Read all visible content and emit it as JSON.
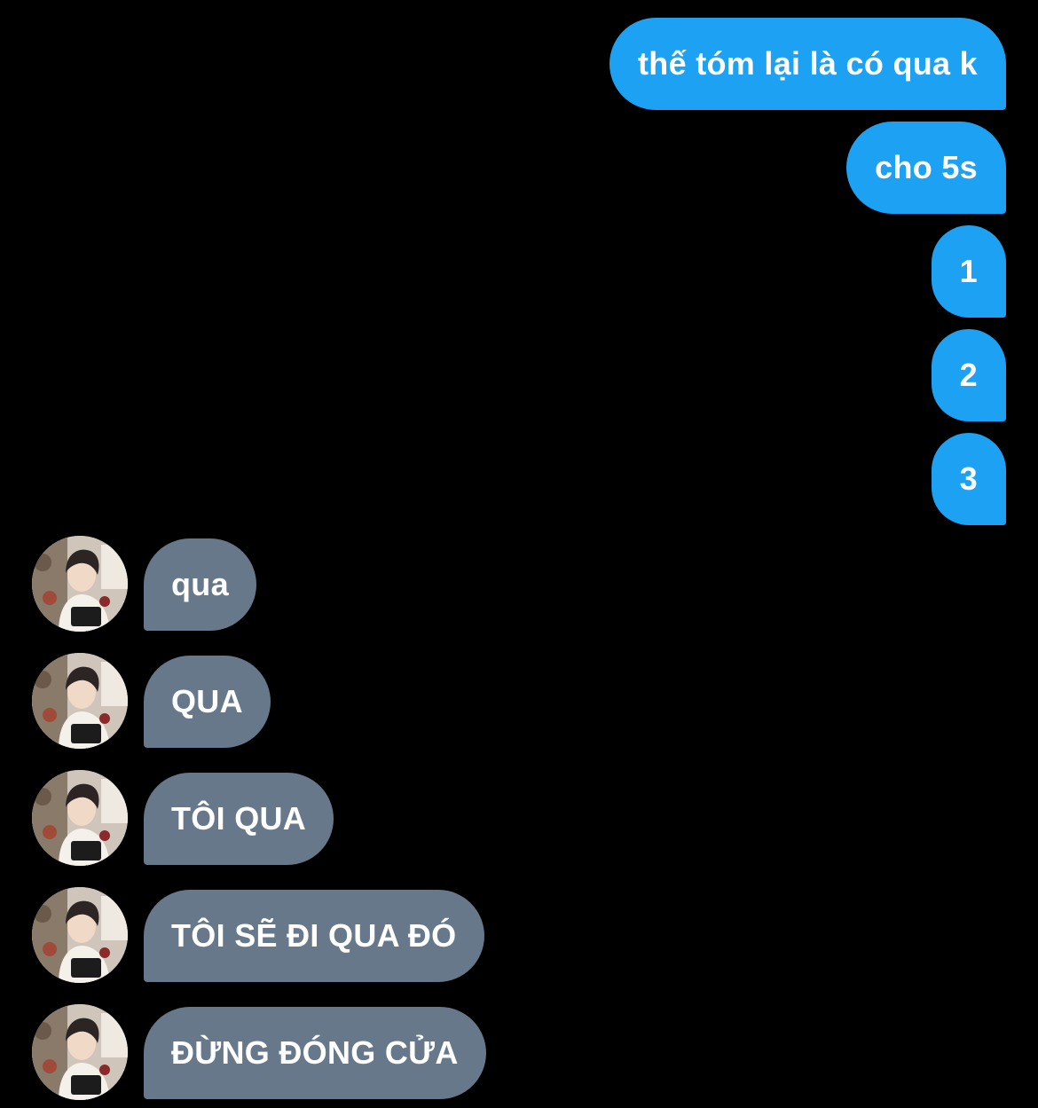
{
  "conversation": {
    "outgoing": [
      {
        "text": "thế tóm lại là có qua k"
      },
      {
        "text": "cho 5s"
      },
      {
        "text": "1"
      },
      {
        "text": "2"
      },
      {
        "text": "3"
      }
    ],
    "incoming": [
      {
        "text": "qua"
      },
      {
        "text": "QUA"
      },
      {
        "text": "TÔI QUA"
      },
      {
        "text": "TÔI SẼ ĐI QUA ĐÓ"
      },
      {
        "text": "ĐỪNG ĐÓNG CỬA"
      }
    ]
  },
  "colors": {
    "background": "#000000",
    "outgoing_bubble": "#1da1f2",
    "incoming_bubble": "#66788a",
    "text": "#ffffff"
  }
}
